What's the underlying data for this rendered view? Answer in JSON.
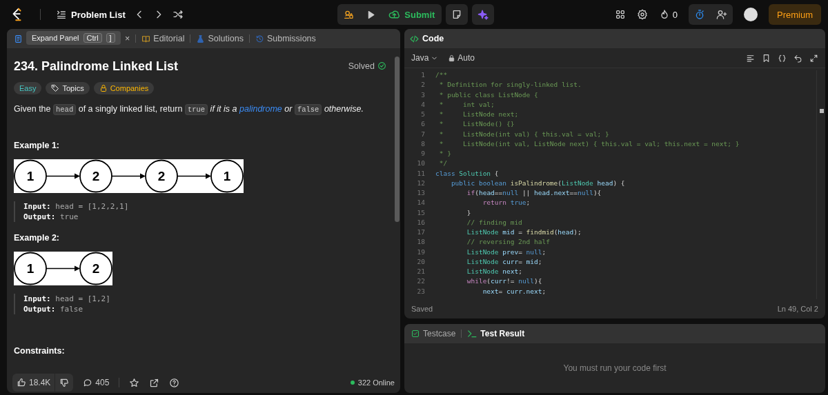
{
  "topbar": {
    "problem_list": "Problem List",
    "submit": "Submit",
    "streak": "0",
    "premium": "Premium"
  },
  "description_panel": {
    "tabs": [
      {
        "kind": "description",
        "selected": true
      },
      {
        "kind": "note",
        "label": "×",
        "selected": false
      },
      {
        "kind": "editorial",
        "label": "Editorial",
        "selected": false
      },
      {
        "kind": "solutions",
        "label": "Solutions",
        "selected": false
      },
      {
        "kind": "submissions",
        "label": "Submissions",
        "selected": false
      }
    ],
    "tooltip": {
      "text": "Expand Panel",
      "keys": [
        "Ctrl",
        "]"
      ]
    },
    "title": "234. Palindrome Linked List",
    "status": "Solved",
    "tags": [
      {
        "kind": "difficulty",
        "label": "Easy"
      },
      {
        "kind": "topics",
        "label": "Topics"
      },
      {
        "kind": "companies",
        "label": "Companies"
      }
    ],
    "statement": [
      {
        "kind": "text",
        "text": "Given the "
      },
      {
        "kind": "code",
        "text": "head"
      },
      {
        "kind": "text",
        "text": " of a singly linked list, return "
      },
      {
        "kind": "code",
        "text": "true"
      },
      {
        "kind": "italic",
        "text": " if it is a "
      },
      {
        "kind": "link",
        "text": "palindrome"
      },
      {
        "kind": "italic",
        "text": " or "
      },
      {
        "kind": "code",
        "text": "false"
      },
      {
        "kind": "italic",
        "text": " otherwise."
      }
    ],
    "examples": [
      {
        "heading": "Example 1:",
        "nodes": [
          "1",
          "2",
          "2",
          "1"
        ],
        "input": "**Input:** head = [1,2,2,1]",
        "output": "**Output:** true"
      },
      {
        "heading": "Example 2:",
        "nodes": [
          "1",
          "2"
        ],
        "input": "**Input:** head = [1,2]",
        "output": "**Output:** false"
      }
    ],
    "constraints_heading": "Constraints:",
    "footer": {
      "likes": "18.4K",
      "comments": "405",
      "online": "322 Online"
    }
  },
  "code_panel": {
    "title": "Code",
    "language": "Java",
    "mode": "Auto",
    "status": "Saved",
    "cursor": "Ln 49, Col 2",
    "lines": [
      {
        "number": "1",
        "tokens": [
          {
            "kind": "comment",
            "text": "/**"
          }
        ]
      },
      {
        "number": "2",
        "tokens": [
          {
            "kind": "comment",
            "text": " * Definition for singly-linked list."
          }
        ]
      },
      {
        "number": "3",
        "tokens": [
          {
            "kind": "comment",
            "text": " * public class ListNode {"
          }
        ]
      },
      {
        "number": "4",
        "tokens": [
          {
            "kind": "comment",
            "text": " *     int val;"
          }
        ]
      },
      {
        "number": "5",
        "tokens": [
          {
            "kind": "comment",
            "text": " *     ListNode next;"
          }
        ]
      },
      {
        "number": "6",
        "tokens": [
          {
            "kind": "comment",
            "text": " *     ListNode() {}"
          }
        ]
      },
      {
        "number": "7",
        "tokens": [
          {
            "kind": "comment",
            "text": " *     ListNode(int val) { this.val = val; }"
          }
        ]
      },
      {
        "number": "8",
        "tokens": [
          {
            "kind": "comment",
            "text": " *     ListNode(int val, ListNode next) { this.val = val; this.next = next; }"
          }
        ]
      },
      {
        "number": "9",
        "tokens": [
          {
            "kind": "comment",
            "text": " * }"
          }
        ]
      },
      {
        "number": "10",
        "tokens": [
          {
            "kind": "comment",
            "text": " */"
          }
        ]
      },
      {
        "number": "11",
        "tokens": [
          {
            "kind": "keyword",
            "text": "class "
          },
          {
            "kind": "type",
            "text": "Solution"
          },
          {
            "kind": "plain",
            "text": " {"
          }
        ]
      },
      {
        "number": "12",
        "tokens": [
          {
            "kind": "keyword",
            "text": "    public boolean "
          },
          {
            "kind": "function",
            "text": "isPalindrome"
          },
          {
            "kind": "plain",
            "text": "("
          },
          {
            "kind": "type",
            "text": "ListNode "
          },
          {
            "kind": "variable",
            "text": "head"
          },
          {
            "kind": "plain",
            "text": ") {"
          }
        ]
      },
      {
        "number": "13",
        "tokens": [
          {
            "kind": "control",
            "text": "        if"
          },
          {
            "kind": "plain",
            "text": "("
          },
          {
            "kind": "variable",
            "text": "head"
          },
          {
            "kind": "plain",
            "text": "=="
          },
          {
            "kind": "keyword",
            "text": "null"
          },
          {
            "kind": "plain",
            "text": " || "
          },
          {
            "kind": "variable",
            "text": "head.next"
          },
          {
            "kind": "plain",
            "text": "=="
          },
          {
            "kind": "keyword",
            "text": "null"
          },
          {
            "kind": "plain",
            "text": "){"
          }
        ]
      },
      {
        "number": "14",
        "tokens": [
          {
            "kind": "control",
            "text": "            return "
          },
          {
            "kind": "keyword",
            "text": "true"
          },
          {
            "kind": "plain",
            "text": ";"
          }
        ]
      },
      {
        "number": "15",
        "tokens": [
          {
            "kind": "plain",
            "text": "        }"
          }
        ]
      },
      {
        "number": "16",
        "tokens": [
          {
            "kind": "comment",
            "text": "        // finding mid"
          }
        ]
      },
      {
        "number": "17",
        "tokens": [
          {
            "kind": "type",
            "text": "        ListNode "
          },
          {
            "kind": "variable",
            "text": "mid"
          },
          {
            "kind": "plain",
            "text": " = "
          },
          {
            "kind": "function",
            "text": "findmid"
          },
          {
            "kind": "plain",
            "text": "("
          },
          {
            "kind": "variable",
            "text": "head"
          },
          {
            "kind": "plain",
            "text": ");"
          }
        ]
      },
      {
        "number": "18",
        "tokens": [
          {
            "kind": "comment",
            "text": "        // reversing 2nd half"
          }
        ]
      },
      {
        "number": "19",
        "tokens": [
          {
            "kind": "type",
            "text": "        ListNode "
          },
          {
            "kind": "variable",
            "text": "prev"
          },
          {
            "kind": "plain",
            "text": "= "
          },
          {
            "kind": "keyword",
            "text": "null"
          },
          {
            "kind": "plain",
            "text": ";"
          }
        ]
      },
      {
        "number": "20",
        "tokens": [
          {
            "kind": "type",
            "text": "        ListNode "
          },
          {
            "kind": "variable",
            "text": "curr"
          },
          {
            "kind": "plain",
            "text": "= "
          },
          {
            "kind": "variable",
            "text": "mid"
          },
          {
            "kind": "plain",
            "text": ";"
          }
        ]
      },
      {
        "number": "21",
        "tokens": [
          {
            "kind": "type",
            "text": "        ListNode "
          },
          {
            "kind": "variable",
            "text": "next"
          },
          {
            "kind": "plain",
            "text": ";"
          }
        ]
      },
      {
        "number": "22",
        "tokens": [
          {
            "kind": "control",
            "text": "        while"
          },
          {
            "kind": "plain",
            "text": "("
          },
          {
            "kind": "variable",
            "text": "curr"
          },
          {
            "kind": "plain",
            "text": "!= "
          },
          {
            "kind": "keyword",
            "text": "null"
          },
          {
            "kind": "plain",
            "text": "){"
          }
        ]
      },
      {
        "number": "23",
        "tokens": [
          {
            "kind": "variable",
            "text": "            next"
          },
          {
            "kind": "plain",
            "text": "= "
          },
          {
            "kind": "variable",
            "text": "curr.next"
          },
          {
            "kind": "plain",
            "text": ";"
          }
        ]
      }
    ]
  },
  "test_panel": {
    "tabs": [
      {
        "kind": "testcase",
        "label": "Testcase",
        "selected": false
      },
      {
        "kind": "result",
        "label": "Test Result",
        "selected": true
      }
    ],
    "message": "You must run your code first"
  }
}
